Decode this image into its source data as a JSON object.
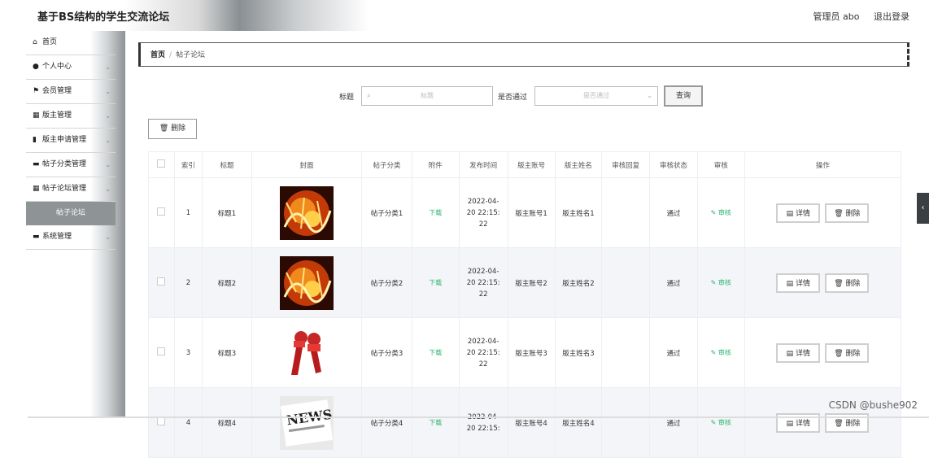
{
  "header": {
    "title": "基于BS结构的学生交流论坛",
    "user": "管理员 abo",
    "logout": "退出登录"
  },
  "sidebar": {
    "items": [
      {
        "label": "首页",
        "icon": "home-icon",
        "chevron": false
      },
      {
        "label": "个人中心",
        "icon": "user-icon",
        "chevron": true
      },
      {
        "label": "会员管理",
        "icon": "flag-icon",
        "chevron": true
      },
      {
        "label": "版主管理",
        "icon": "grid-icon",
        "chevron": true
      },
      {
        "label": "版主申请管理",
        "icon": "bar-chart-icon",
        "chevron": true
      },
      {
        "label": "帖子分类管理",
        "icon": "folder-icon",
        "chevron": true
      },
      {
        "label": "帖子论坛管理",
        "icon": "grid-icon",
        "chevron": true
      },
      {
        "label": "帖子论坛",
        "icon": "",
        "chevron": false,
        "sub": true
      },
      {
        "label": "系统管理",
        "icon": "chat-icon",
        "chevron": true
      }
    ]
  },
  "breadcrumb": {
    "home": "首页",
    "sep": "/",
    "current": "帖子论坛"
  },
  "search": {
    "title_label": "标题",
    "title_placeholder": "标题",
    "passed_label": "是否通过",
    "passed_placeholder": "是否通过",
    "query_button": "查询"
  },
  "toolbar": {
    "delete_label": "删除"
  },
  "table": {
    "headers": [
      "索引",
      "标题",
      "封面",
      "帖子分类",
      "附件",
      "发布时间",
      "版主账号",
      "版主姓名",
      "审核回复",
      "审核状态",
      "审核",
      "操作"
    ],
    "rows": [
      {
        "index": "1",
        "title": "标题1",
        "cover": "fire",
        "category": "帖子分类1",
        "attachment": "下载",
        "date1": "2022-04-",
        "date2": "20 22:15:",
        "date3": "22",
        "account": "版主账号1",
        "name": "版主姓名1",
        "reply": "",
        "status": "通过",
        "audit": "审核",
        "detail": "详情",
        "delete": "删除"
      },
      {
        "index": "2",
        "title": "标题2",
        "cover": "fire",
        "category": "帖子分类2",
        "attachment": "下载",
        "date1": "2022-04-",
        "date2": "20 22:15:",
        "date3": "22",
        "account": "版主账号2",
        "name": "版主姓名2",
        "reply": "",
        "status": "通过",
        "audit": "审核",
        "detail": "详情",
        "delete": "删除"
      },
      {
        "index": "3",
        "title": "标题3",
        "cover": "microphone",
        "category": "帖子分类3",
        "attachment": "下载",
        "date1": "2022-04-",
        "date2": "20 22:15:",
        "date3": "22",
        "account": "版主账号3",
        "name": "版主姓名3",
        "reply": "",
        "status": "通过",
        "audit": "审核",
        "detail": "详情",
        "delete": "删除"
      },
      {
        "index": "4",
        "title": "标题4",
        "cover": "news",
        "category": "帖子分类4",
        "attachment": "下载",
        "date1": "2022-04-",
        "date2": "20 22:15:",
        "date3": "",
        "account": "版主账号4",
        "name": "版主姓名4",
        "reply": "",
        "status": "通过",
        "audit": "审核",
        "detail": "详情",
        "delete": "删除"
      }
    ]
  },
  "watermark": "CSDN @bushe902",
  "colors": {
    "green": "#2bb46e",
    "sidebar_active": "#8e9396"
  }
}
